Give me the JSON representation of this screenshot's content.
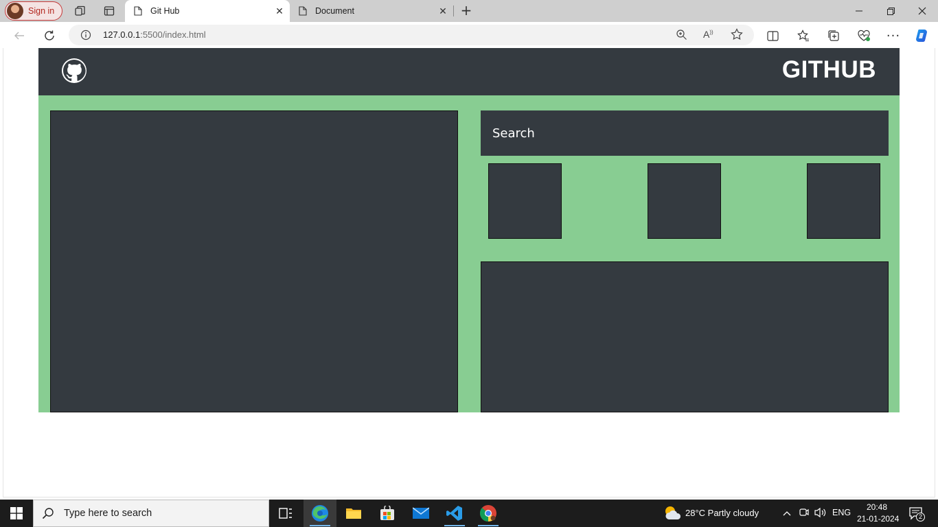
{
  "browser": {
    "signin_label": "Sign in",
    "tabs": [
      {
        "title": "Git Hub",
        "active": true
      },
      {
        "title": "Document",
        "active": false
      }
    ],
    "new_tab": "+",
    "url_host": "127.0.0.1",
    "url_rest": ":5500/index.html"
  },
  "site": {
    "title": "GITHUB",
    "search_placeholder": "Search",
    "colors": {
      "header": "#343a40",
      "main": "#88cd92",
      "panel": "#343a40"
    }
  },
  "taskbar": {
    "search_placeholder": "Type here to search",
    "weather": "28°C  Partly cloudy",
    "lang": "ENG",
    "time": "20:48",
    "date": "21-01-2024",
    "notifications": "2"
  }
}
